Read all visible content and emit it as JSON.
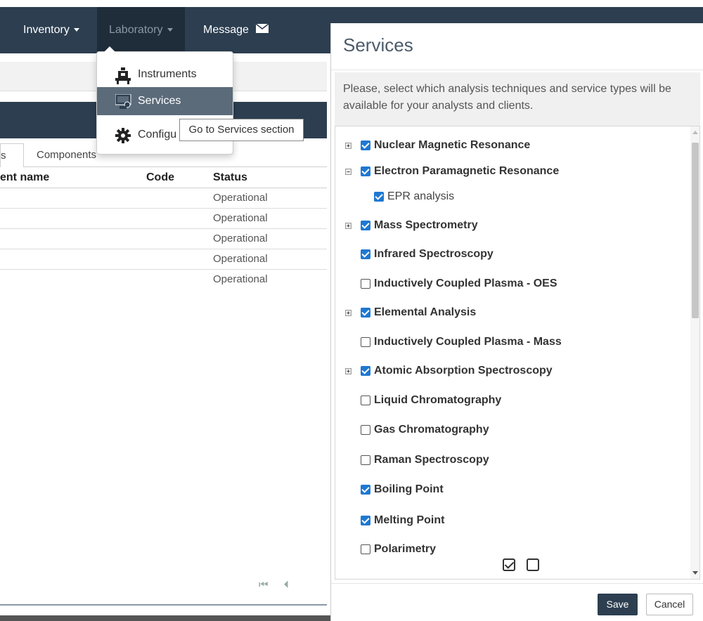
{
  "nav": {
    "inventory": "Inventory",
    "laboratory": "Laboratory",
    "message": "Message"
  },
  "dropdown": {
    "items": [
      {
        "label": "Instruments",
        "icon": "instrument-icon"
      },
      {
        "label": "Services",
        "icon": "services-icon"
      },
      {
        "label": "Configu",
        "icon": "gear-icon"
      }
    ]
  },
  "tooltip": "Go to Services section",
  "background": {
    "tab_active": "s",
    "tab_components": "Components",
    "columns": [
      "ent name",
      "Code",
      "Status"
    ],
    "rows": [
      "Operational",
      "Operational",
      "Operational",
      "Operational",
      "Operational"
    ]
  },
  "modal": {
    "title": "Services",
    "description": "Please, select which analysis techniques and service types will be available for your analysts and clients.",
    "items": [
      {
        "label": "Nuclear Magnetic Resonance",
        "checked": true,
        "expander": "+"
      },
      {
        "label": "Electron Paramagnetic Resonance",
        "checked": true,
        "expander": "-"
      },
      {
        "label": "EPR analysis",
        "checked": true,
        "expander": ""
      },
      {
        "label": "Mass Spectrometry",
        "checked": true,
        "expander": "+"
      },
      {
        "label": "Infrared Spectroscopy",
        "checked": true,
        "expander": ""
      },
      {
        "label": "Inductively Coupled Plasma - OES",
        "checked": false,
        "expander": ""
      },
      {
        "label": "Elemental Analysis",
        "checked": true,
        "expander": "+"
      },
      {
        "label": "Inductively Coupled Plasma - Mass",
        "checked": false,
        "expander": ""
      },
      {
        "label": "Atomic Absorption Spectroscopy",
        "checked": true,
        "expander": "+"
      },
      {
        "label": "Liquid Chromatography",
        "checked": false,
        "expander": ""
      },
      {
        "label": "Gas Chromatography",
        "checked": false,
        "expander": ""
      },
      {
        "label": "Raman Spectroscopy",
        "checked": false,
        "expander": ""
      },
      {
        "label": "Boiling Point",
        "checked": true,
        "expander": ""
      },
      {
        "label": "Melting Point",
        "checked": true,
        "expander": ""
      },
      {
        "label": "Polarimetry",
        "checked": false,
        "expander": ""
      }
    ],
    "save_label": "Save",
    "cancel_label": "Cancel"
  },
  "colors": {
    "navbar": "#2c3e50",
    "checkbox_accent": "#1f78d1",
    "dropdown_active": "#5b6b7a"
  }
}
